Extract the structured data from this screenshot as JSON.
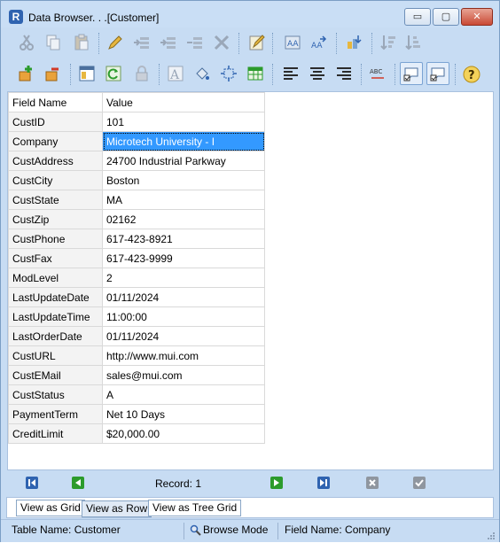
{
  "window": {
    "title": "Data Browser. . .[Customer]",
    "controls": {
      "minimize": "▭",
      "maximize": "▢",
      "close": "✕"
    }
  },
  "colors": {
    "chrome": "#c7dcf3",
    "selection": "#3399ff",
    "close_button": "#c94a35"
  },
  "toolbar_row1": [
    "cut-icon",
    "copy-icon",
    "paste-icon",
    "edit-pencil-icon",
    "insert-row-before-icon",
    "insert-row-after-icon",
    "append-row-icon",
    "delete-icon",
    "edit-record-icon",
    "find-icon",
    "find-next-icon",
    "filter-icon",
    "sort-ascending-icon",
    "sort-descending-icon"
  ],
  "toolbar_row2": [
    "add-icon",
    "remove-icon",
    "layout-icon",
    "refresh-icon",
    "lock-icon",
    "font-icon",
    "fill-color-icon",
    "fit-icon",
    "grid-icon",
    "align-left-icon",
    "align-center-icon",
    "align-right-icon",
    "spellcheck-icon",
    "comment-check-icon",
    "comment-check-alt-icon",
    "help-icon"
  ],
  "grid": {
    "headers": {
      "name": "Field Name",
      "value": "Value"
    },
    "rows": [
      {
        "name": "CustID",
        "value": "101"
      },
      {
        "name": "Company",
        "value": "Microtech University - I"
      },
      {
        "name": "CustAddress",
        "value": "24700 Industrial Parkway"
      },
      {
        "name": "CustCity",
        "value": "Boston"
      },
      {
        "name": "CustState",
        "value": "MA"
      },
      {
        "name": "CustZip",
        "value": "02162"
      },
      {
        "name": "CustPhone",
        "value": "617-423-8921"
      },
      {
        "name": "CustFax",
        "value": "617-423-9999"
      },
      {
        "name": "ModLevel",
        "value": "2"
      },
      {
        "name": "LastUpdateDate",
        "value": "01/11/2024"
      },
      {
        "name": "LastUpdateTime",
        "value": "11:00:00"
      },
      {
        "name": "LastOrderDate",
        "value": "01/11/2024"
      },
      {
        "name": "CustURL",
        "value": "http://www.mui.com"
      },
      {
        "name": "CustEMail",
        "value": "sales@mui.com"
      },
      {
        "name": "CustStatus",
        "value": "A"
      },
      {
        "name": "PaymentTerm",
        "value": "Net 10 Days"
      },
      {
        "name": "CreditLimit",
        "value": "$20,000.00"
      }
    ]
  },
  "navigator": {
    "record_label": "Record: 1",
    "buttons": [
      "first-record-icon",
      "previous-record-icon",
      "next-record-icon",
      "last-record-icon",
      "cancel-icon",
      "confirm-icon"
    ]
  },
  "tabs": [
    {
      "label": "View as Grid"
    },
    {
      "label": "View as Row"
    },
    {
      "label": "View as Tree Grid"
    }
  ],
  "status": {
    "table_name": "Table Name: Customer",
    "mode": "Browse Mode",
    "field_name": "Field Name: Company"
  }
}
